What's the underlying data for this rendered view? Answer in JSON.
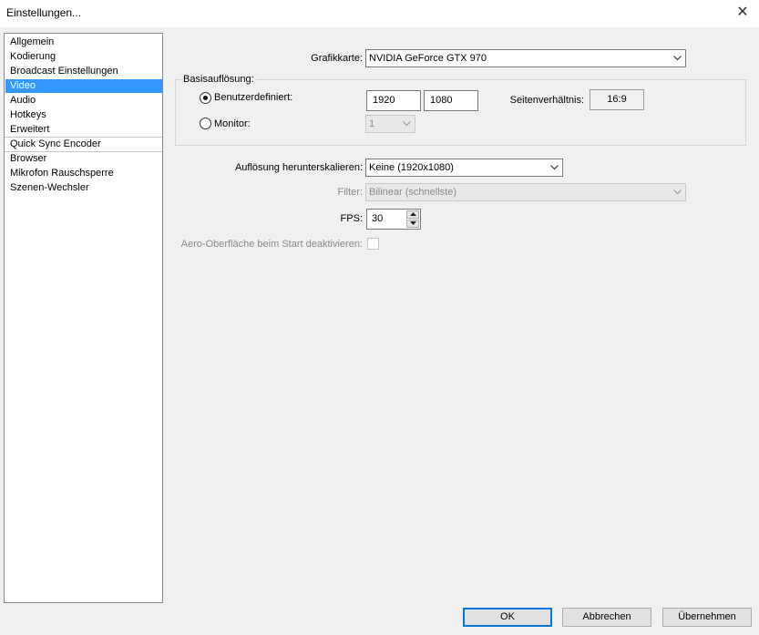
{
  "window": {
    "title": "Einstellungen...",
    "close_glyph": "✕"
  },
  "sidebar": {
    "items": [
      "Allgemein",
      "Kodierung",
      "Broadcast Einstellungen",
      "Video",
      "Audio",
      "Hotkeys",
      "Erweitert",
      "Quick Sync Encoder",
      "Browser",
      "Mikrofon Rauschsperre",
      "Szenen-Wechsler"
    ],
    "selected": "Video",
    "selection_color": "#3399ff"
  },
  "video": {
    "gpu_label": "Grafikkarte:",
    "gpu_value": "NVIDIA GeForce GTX 970",
    "base_res_group": "Basisauflösung:",
    "custom_label": "Benutzerdefiniert:",
    "custom_selected": true,
    "width": "1920",
    "height": "1080",
    "aspect_label": "Seitenverhältnis:",
    "aspect_value": "16:9",
    "monitor_label": "Monitor:",
    "monitor_value": "1",
    "downscale_label": "Auflösung herunterskalieren:",
    "downscale_value": "Keine  (1920x1080)",
    "filter_label": "Filter:",
    "filter_value": "Bilinear (schnellste)",
    "fps_label": "FPS:",
    "fps_value": "30",
    "aero_label": "Aero-Oberfläche beim Start deaktivieren:",
    "aero_checked": false
  },
  "buttons": {
    "ok": "OK",
    "cancel": "Abbrechen",
    "apply": "Übernehmen"
  }
}
